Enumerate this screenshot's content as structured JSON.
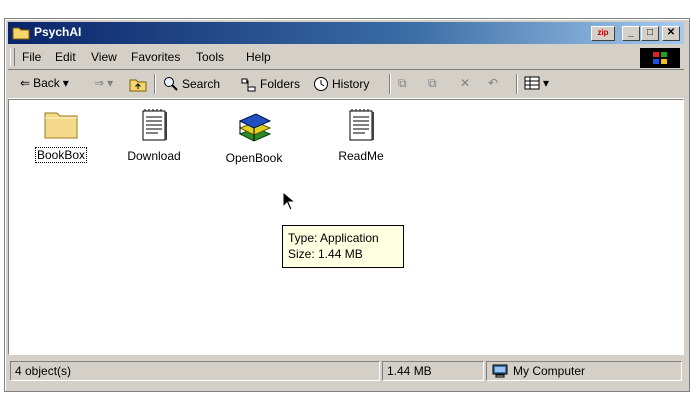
{
  "window": {
    "title": "PsychAI"
  },
  "menu": [
    "File",
    "Edit",
    "View",
    "Favorites",
    "Tools",
    "Help"
  ],
  "toolbar": {
    "back": "Back",
    "search": "Search",
    "folders": "Folders",
    "history": "History"
  },
  "files": [
    {
      "name": "BookBox",
      "icon": "folder-icon"
    },
    {
      "name": "Download",
      "icon": "notepad-icon"
    },
    {
      "name": "OpenBook",
      "icon": "books-icon"
    },
    {
      "name": "ReadMe",
      "icon": "notepad-icon"
    }
  ],
  "tooltip": {
    "type": "Type: Application",
    "size": "Size: 1.44 MB"
  },
  "status": {
    "objects": "4 object(s)",
    "size": "1.44 MB",
    "location": "My Computer"
  }
}
